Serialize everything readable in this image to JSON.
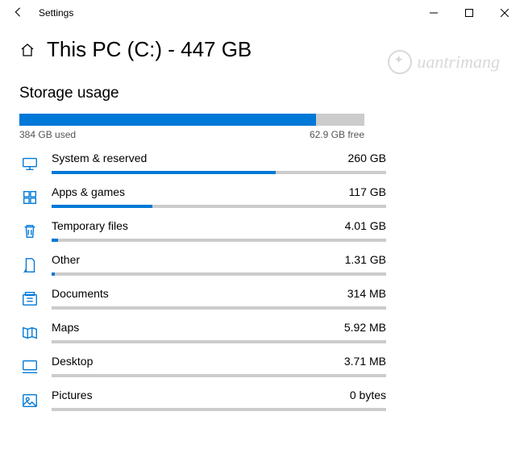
{
  "window": {
    "title": "Settings"
  },
  "header": {
    "page_title": "This PC (C:) - 447 GB"
  },
  "storage": {
    "section_title": "Storage usage",
    "used_label": "384 GB used",
    "free_label": "62.9 GB free",
    "used_percent": 85.9
  },
  "categories": [
    {
      "name": "System & reserved",
      "size": "260 GB",
      "percent": 67
    },
    {
      "name": "Apps & games",
      "size": "117 GB",
      "percent": 30
    },
    {
      "name": "Temporary files",
      "size": "4.01 GB",
      "percent": 2
    },
    {
      "name": "Other",
      "size": "1.31 GB",
      "percent": 1
    },
    {
      "name": "Documents",
      "size": "314 MB",
      "percent": 0
    },
    {
      "name": "Maps",
      "size": "5.92 MB",
      "percent": 0
    },
    {
      "name": "Desktop",
      "size": "3.71 MB",
      "percent": 0
    },
    {
      "name": "Pictures",
      "size": "0 bytes",
      "percent": 0
    }
  ],
  "watermark": "uantrimang"
}
